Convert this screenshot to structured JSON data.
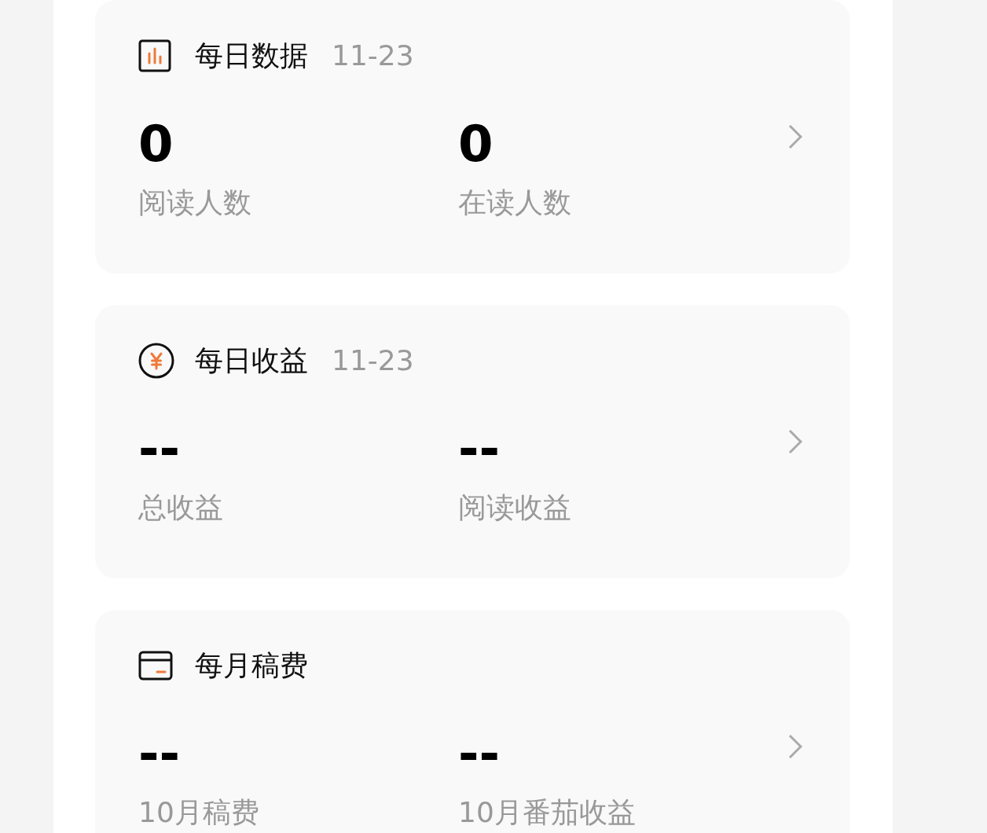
{
  "cards": [
    {
      "kind": "chart",
      "title": "每日数据",
      "date": "11-23",
      "stats": [
        {
          "value": "0",
          "label": "阅读人数"
        },
        {
          "value": "0",
          "label": "在读人数"
        }
      ]
    },
    {
      "kind": "coin",
      "title": "每日收益",
      "date": "11-23",
      "stats": [
        {
          "value": "--",
          "label": "总收益"
        },
        {
          "value": "--",
          "label": "阅读收益"
        }
      ]
    },
    {
      "kind": "wallet",
      "title": "每月稿费",
      "stats": [
        {
          "value": "--",
          "label": "10月稿费"
        },
        {
          "value": "--",
          "label": "10月番茄收益"
        }
      ]
    }
  ]
}
